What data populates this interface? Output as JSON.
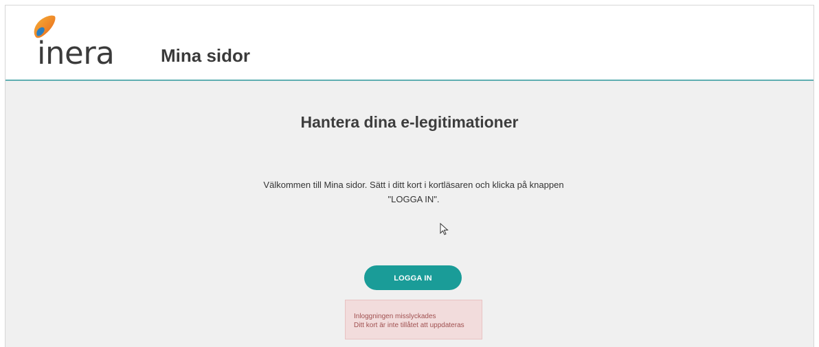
{
  "header": {
    "logo_text": "inera",
    "app_title": "Mina sidor"
  },
  "main": {
    "title": "Hantera dina e-legitimationer",
    "intro_line1": "Välkommen till Mina sidor. Sätt i ditt kort i kortläsaren och klicka på knappen",
    "intro_line2": "\"LOGGA IN\".",
    "login_button_label": "LOGGA IN",
    "error": {
      "title": "Inloggningen misslyckades",
      "message": "Ditt kort är inte tillåtet att uppdateras"
    }
  },
  "colors": {
    "accent": "#1a9c98",
    "header_border": "#5eaeb1",
    "error_bg": "#f2dcdc",
    "error_text": "#a05050",
    "logo_orange": "#f08a24",
    "logo_blue": "#2a7fc0"
  },
  "icons": {
    "logo": "inera-logo-mark",
    "cursor": "mouse-pointer-icon"
  }
}
